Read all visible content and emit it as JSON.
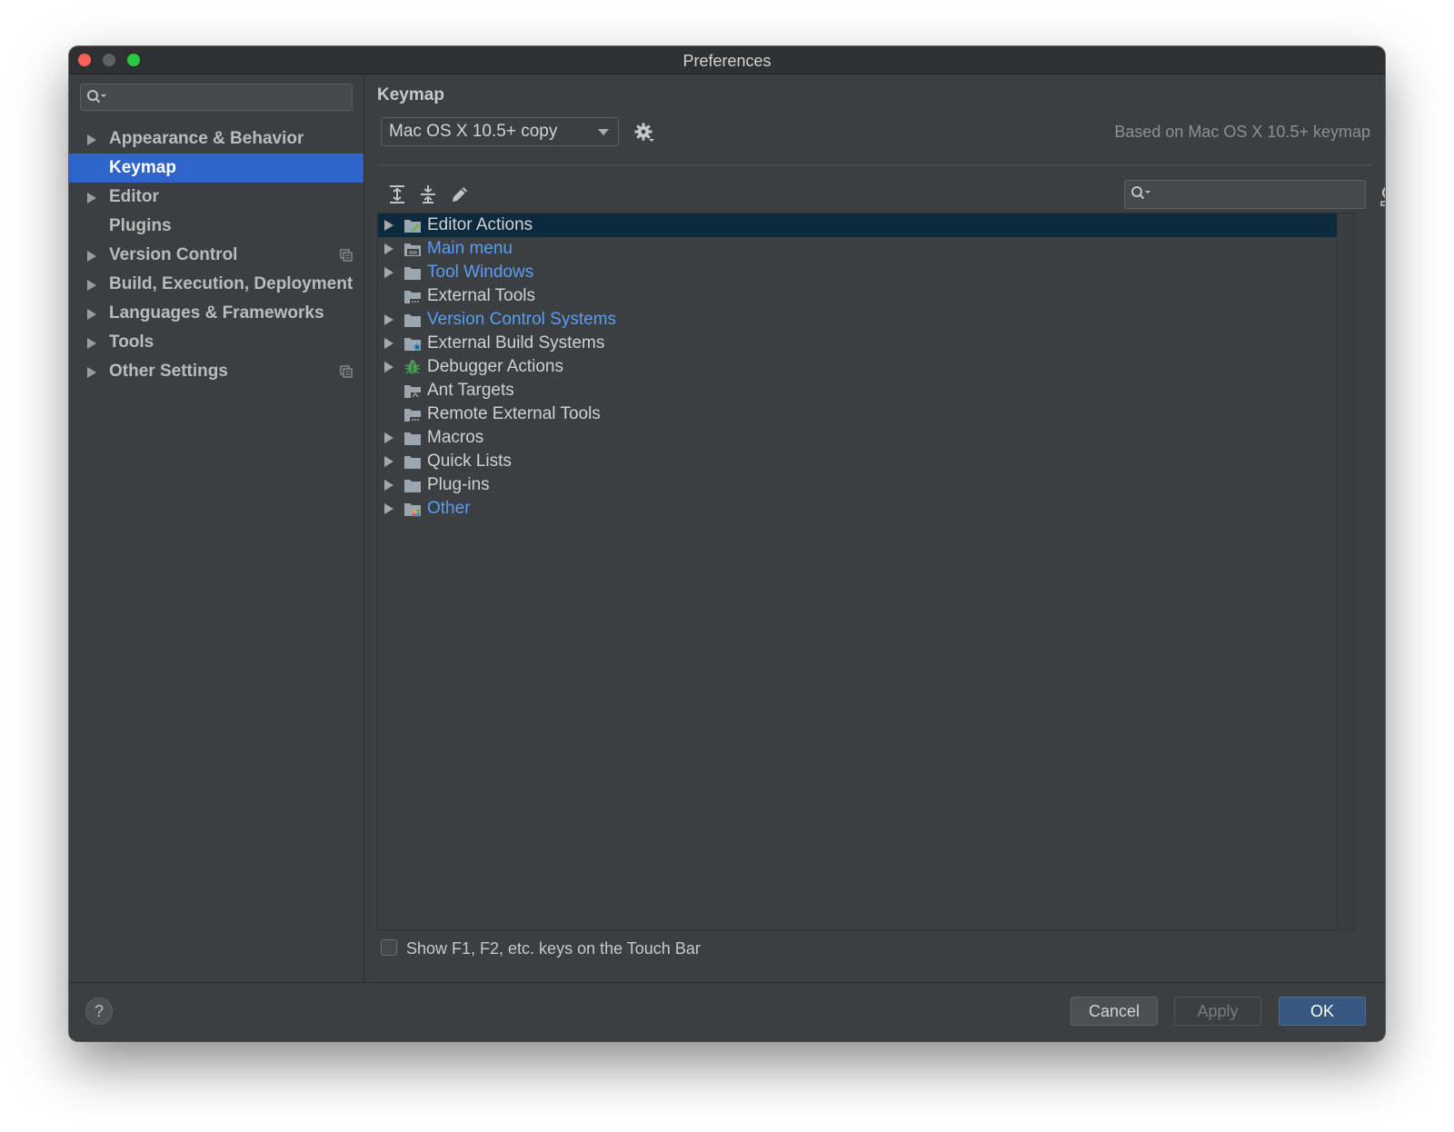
{
  "window": {
    "title": "Preferences"
  },
  "sidebar": {
    "search": {
      "placeholder": ""
    },
    "items": [
      {
        "label": "Appearance & Behavior",
        "expandable": true,
        "selected": false,
        "project_icon": false
      },
      {
        "label": "Keymap",
        "expandable": false,
        "selected": true,
        "project_icon": false
      },
      {
        "label": "Editor",
        "expandable": true,
        "selected": false,
        "project_icon": false
      },
      {
        "label": "Plugins",
        "expandable": false,
        "selected": false,
        "project_icon": false
      },
      {
        "label": "Version Control",
        "expandable": true,
        "selected": false,
        "project_icon": true
      },
      {
        "label": "Build, Execution, Deployment",
        "expandable": true,
        "selected": false,
        "project_icon": false
      },
      {
        "label": "Languages & Frameworks",
        "expandable": true,
        "selected": false,
        "project_icon": false
      },
      {
        "label": "Tools",
        "expandable": true,
        "selected": false,
        "project_icon": false
      },
      {
        "label": "Other Settings",
        "expandable": true,
        "selected": false,
        "project_icon": true
      }
    ]
  },
  "main": {
    "title": "Keymap",
    "keymap_select": {
      "value": "Mac OS X 10.5+ copy"
    },
    "based_on": "Based on Mac OS X 10.5+ keymap",
    "toolbar": {
      "expand_all_icon": "expand-all-icon",
      "collapse_all_icon": "collapse-all-icon",
      "edit_icon": "pencil-icon",
      "find_shortcut_icon": "find-by-shortcut-icon"
    },
    "search": {
      "placeholder": ""
    },
    "tree": [
      {
        "label": "Editor Actions",
        "expandable": true,
        "modified": false,
        "selected": true,
        "icon": "editor-actions-folder-icon"
      },
      {
        "label": "Main menu",
        "expandable": true,
        "modified": true,
        "selected": false,
        "icon": "main-menu-folder-icon"
      },
      {
        "label": "Tool Windows",
        "expandable": true,
        "modified": true,
        "selected": false,
        "icon": "folder-icon"
      },
      {
        "label": "External Tools",
        "expandable": false,
        "modified": false,
        "selected": false,
        "icon": "external-tools-folder-icon"
      },
      {
        "label": "Version Control Systems",
        "expandable": true,
        "modified": true,
        "selected": false,
        "icon": "folder-icon"
      },
      {
        "label": "External Build Systems",
        "expandable": true,
        "modified": false,
        "selected": false,
        "icon": "build-systems-folder-icon"
      },
      {
        "label": "Debugger Actions",
        "expandable": true,
        "modified": false,
        "selected": false,
        "icon": "debugger-bug-icon"
      },
      {
        "label": "Ant Targets",
        "expandable": false,
        "modified": false,
        "selected": false,
        "icon": "ant-targets-folder-icon"
      },
      {
        "label": "Remote External Tools",
        "expandable": false,
        "modified": false,
        "selected": false,
        "icon": "external-tools-folder-icon"
      },
      {
        "label": "Macros",
        "expandable": true,
        "modified": false,
        "selected": false,
        "icon": "folder-icon"
      },
      {
        "label": "Quick Lists",
        "expandable": true,
        "modified": false,
        "selected": false,
        "icon": "folder-icon"
      },
      {
        "label": "Plug-ins",
        "expandable": true,
        "modified": false,
        "selected": false,
        "icon": "folder-icon"
      },
      {
        "label": "Other",
        "expandable": true,
        "modified": true,
        "selected": false,
        "icon": "other-folder-icon"
      }
    ],
    "touchbar_checkbox": {
      "label": "Show F1, F2, etc. keys on the Touch Bar",
      "checked": false
    }
  },
  "footer": {
    "help_label": "?",
    "cancel_label": "Cancel",
    "apply_label": "Apply",
    "ok_label": "OK"
  },
  "colors": {
    "selection": "#2f65ca",
    "tree_selection": "#0d293e",
    "modified_text": "#589df6",
    "ok_button": "#365880"
  }
}
